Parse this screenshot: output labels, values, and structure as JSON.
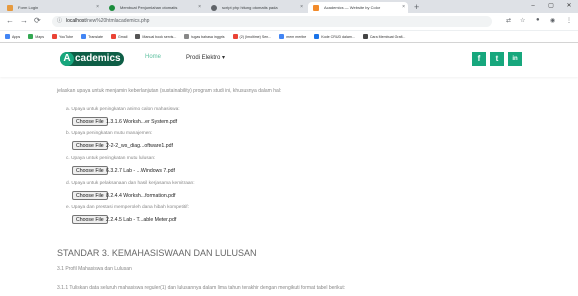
{
  "browser": {
    "tabs": [
      {
        "title": "Form Login",
        "color": "#e69a3f",
        "active": false
      },
      {
        "title": "Membuat Penjumlahan otomatis",
        "color": "#1b8c3c",
        "active": false
      },
      {
        "title": "script php hitung otomatis pada",
        "color": "#5f6368",
        "active": false
      },
      {
        "title": "Academics — Website by Color",
        "color": "#f28b2b",
        "active": true
      }
    ],
    "new_tab_label": "+",
    "window_controls": [
      "–",
      "▢",
      "✕"
    ],
    "address_host": "localhost",
    "address_path": "/new%20htmlacademics.php",
    "bookmarks": [
      {
        "label": "Apps",
        "color": "#4285f4"
      },
      {
        "label": "Maps",
        "color": "#34a853"
      },
      {
        "label": "YouTube",
        "color": "#ea4335"
      },
      {
        "label": "Translate",
        "color": "#4285f4"
      },
      {
        "label": "Gmail",
        "color": "#ea4335"
      },
      {
        "label": "Manual book servis...",
        "color": "#555555"
      },
      {
        "label": "tugas bahasa inggris",
        "color": "#888888"
      },
      {
        "label": "(2) (Imoltime) Sen...",
        "color": "#ea4335"
      },
      {
        "label": "mem meribe",
        "color": "#4285f4"
      },
      {
        "label": "Kode CRUD dalam...",
        "color": "#1a73e8"
      },
      {
        "label": "Cara Membuat Grafi...",
        "color": "#444444"
      }
    ]
  },
  "site": {
    "logo_letter": "A",
    "logo_rest": "cademics",
    "menu_home": "Home",
    "menu_prodi": "Prodi Elektro ▾",
    "social": [
      "f",
      "t",
      "in"
    ],
    "brand_color": "#17a77d"
  },
  "content": {
    "intro": "jelaskan upaya untuk menjamin keberlanjutan (sustainability) program studi ini, khususnya dalam hal:",
    "button_label": "Choose File",
    "items": [
      {
        "label": "a. Upaya untuk peningkatan animo calon mahasiswa:",
        "file": "1.3.1.6 Worksh...er System.pdf"
      },
      {
        "label": "b. Upaya peningkatan mutu manajemen:",
        "file": "2-2-2_ws_diag...oftware1.pdf"
      },
      {
        "label": "c. Upaya untuk peningkatan mutu lulusan:",
        "file": "6.3.2.7 Lab - ...Windows 7.pdf"
      },
      {
        "label": "d. Upaya untuk pelaksanaan dan hasil kerjasama kemitraan:",
        "file": "8.2.4.4 Worksh...formation.pdf"
      },
      {
        "label": "e. Upaya dan prestasi memperoleh dana hibah kompetitif:",
        "file": "2.2.4.5 Lab - T...able Meter.pdf"
      }
    ],
    "standard_title": "STANDAR 3. KEMAHASISWAAN DAN LULUSAN",
    "sub1": "3.1 Profil Mahasiswa dan Lulusan",
    "sub2": "3.1.1 Tuliskan data seluruh mahasiswa reguler(1) dan lulusannya dalam lima tahun terakhir dengan mengikuti format tabel berikut:"
  }
}
